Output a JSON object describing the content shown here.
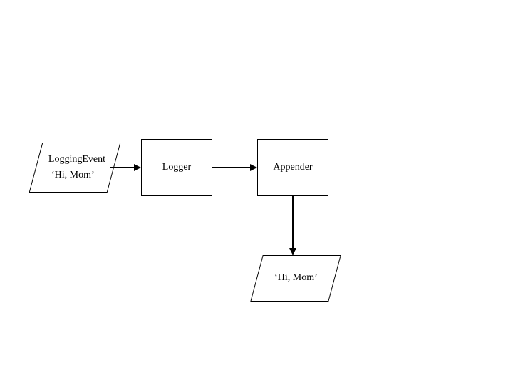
{
  "nodes": {
    "input": {
      "line1": "LoggingEvent",
      "line2": "‘Hi, Mom’"
    },
    "logger": {
      "label": "Logger"
    },
    "appender": {
      "label": "Appender"
    },
    "output": {
      "label": "‘Hi, Mom’"
    }
  }
}
